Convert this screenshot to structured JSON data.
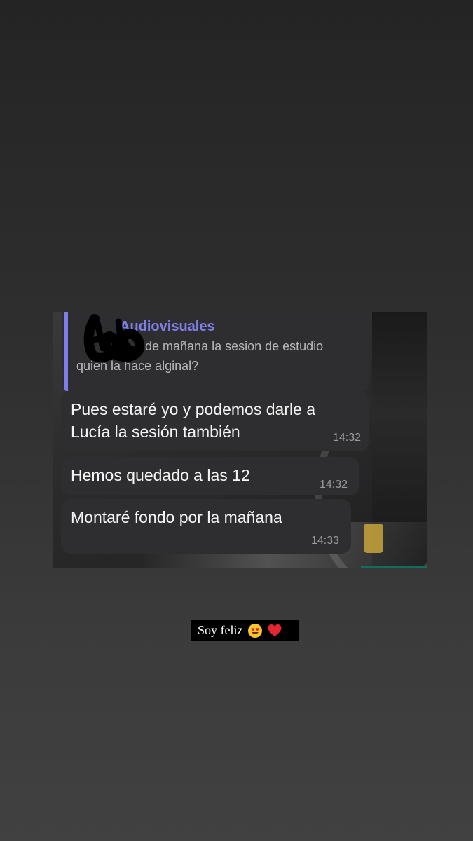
{
  "caption": {
    "text": "Soy feliz",
    "emojis": [
      "heart-eyes-emoji",
      "red-heart-emoji"
    ]
  },
  "chat": {
    "reply_quote": {
      "sender": "Audiovisuales",
      "text_line1": "o de mañana la sesion de estudio",
      "text_line2": "quien la hace alginal?"
    },
    "messages": [
      {
        "line1": "Pues estaré yo y podemos darle a",
        "line2": "Lucía la sesión también",
        "time": "14:32"
      },
      {
        "line1": "Hemos quedado a las 12",
        "time": "14:32"
      },
      {
        "line1": "Montaré fondo por la mañana",
        "time": "14:33"
      }
    ],
    "colors": {
      "bubble": "#2e2e30",
      "accent": "#7f7fe9",
      "text": "#f5f5f5",
      "timestamp": "#9a9a9e"
    }
  }
}
